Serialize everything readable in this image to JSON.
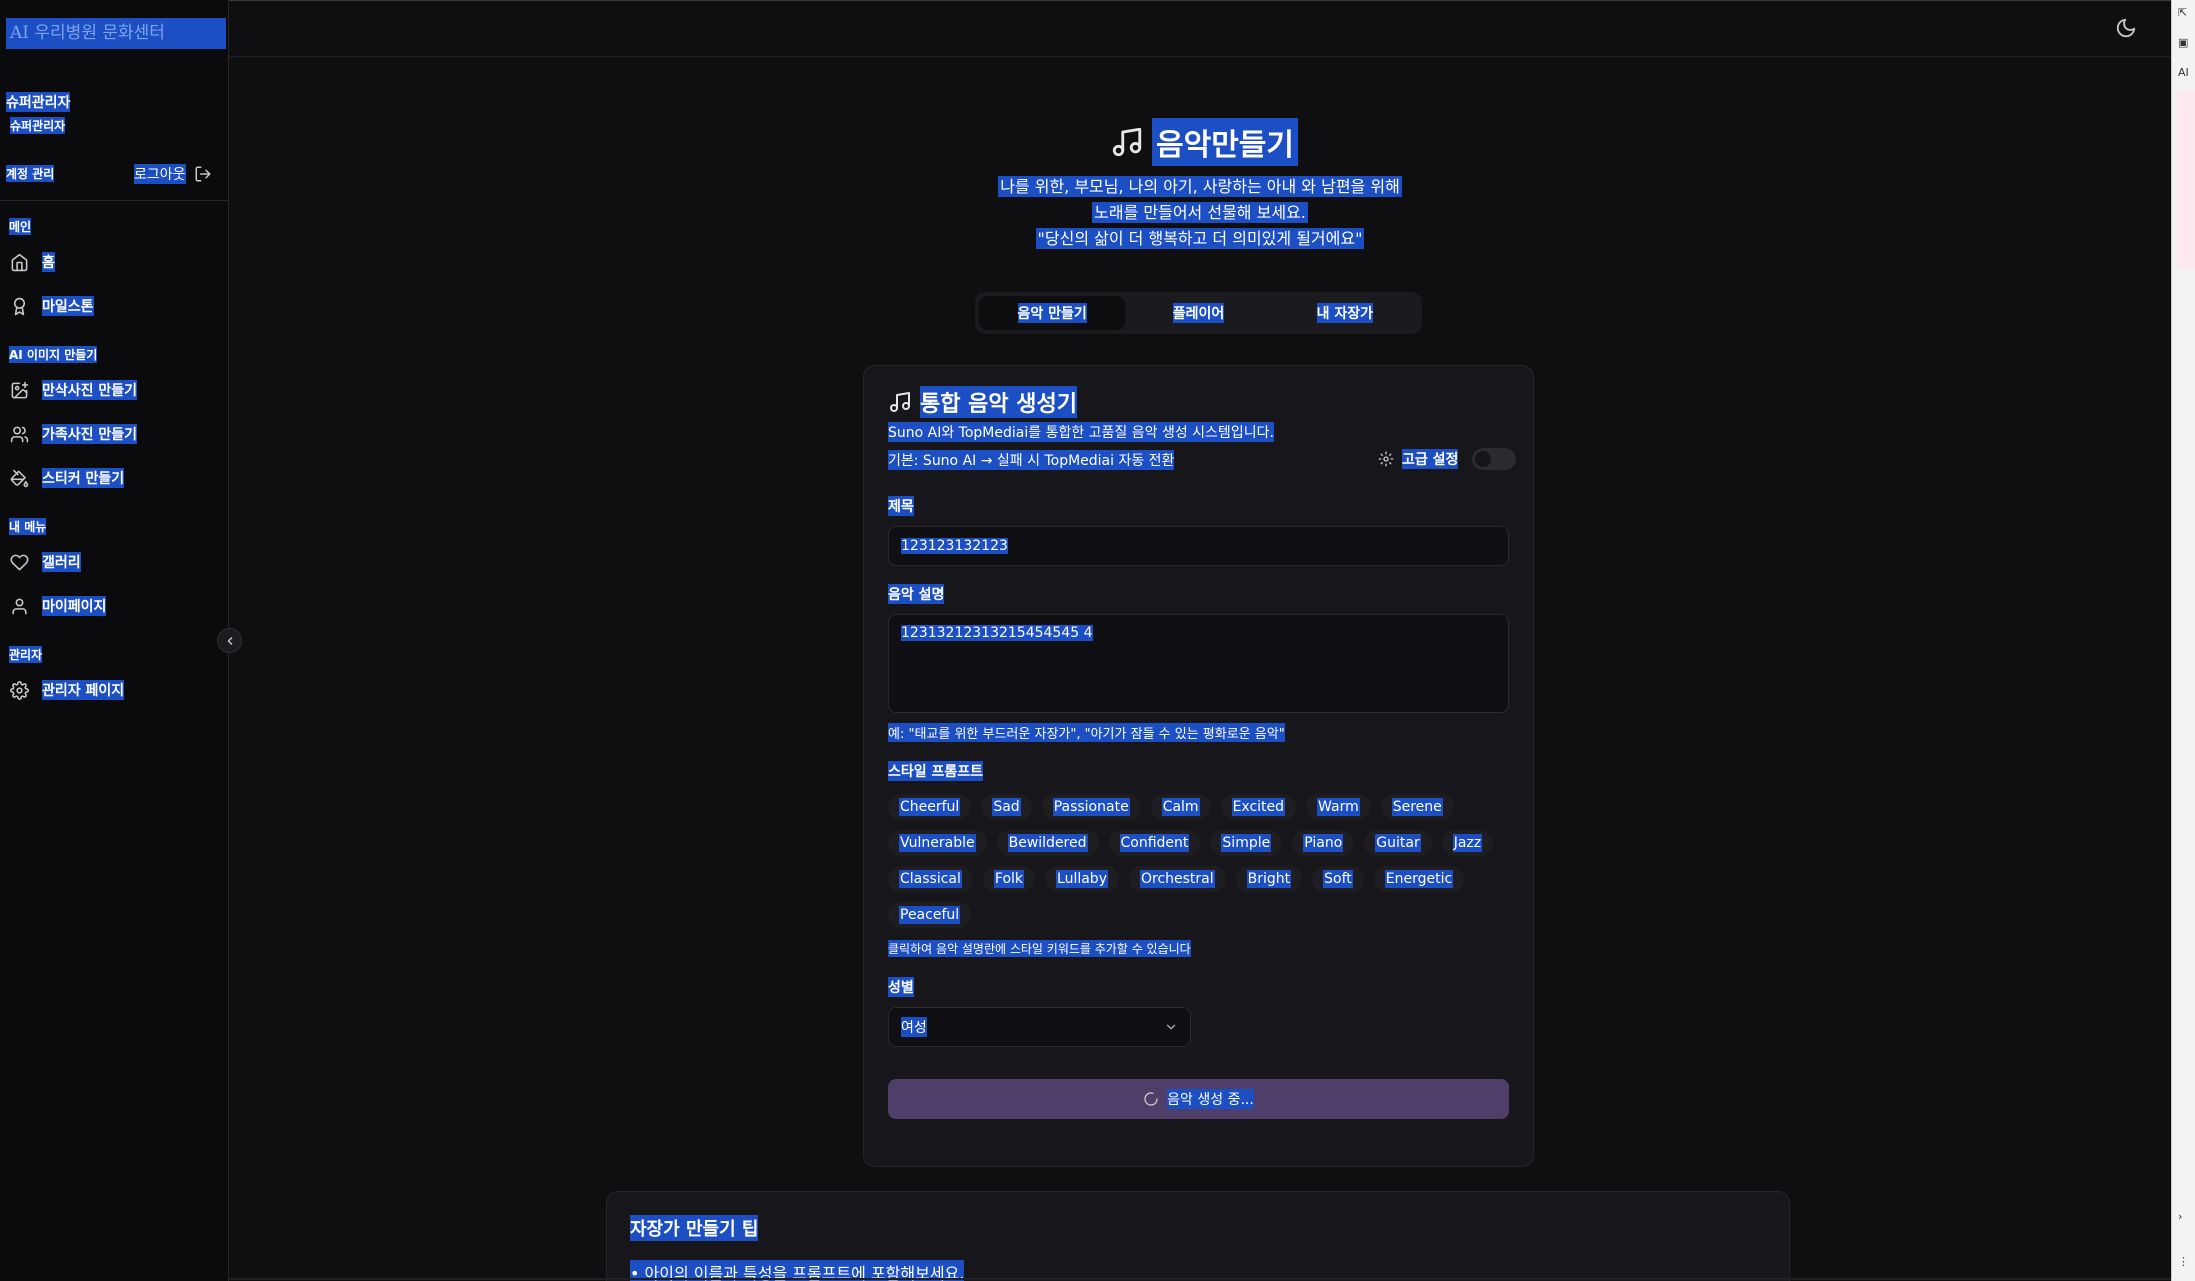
{
  "sidebar": {
    "logo": "AI 우리병원 문화센터",
    "user_name": "슈퍼관리자",
    "user_role": "슈퍼관리자",
    "account_label": "계정 관리",
    "logout_label": "로그아웃",
    "sections": {
      "main": "메인",
      "ai_image": "AI 이미지 만들기",
      "my_menu": "내 메뉴",
      "admin": "관리자"
    },
    "items": [
      {
        "label": "홈",
        "icon": "home-icon"
      },
      {
        "label": "마일스톤",
        "icon": "award-icon"
      },
      {
        "label": "만삭사진 만들기",
        "icon": "image-plus-icon"
      },
      {
        "label": "가족사진 만들기",
        "icon": "users-icon"
      },
      {
        "label": "스티커 만들기",
        "icon": "paint-bucket-icon"
      },
      {
        "label": "갤러리",
        "icon": "heart-icon"
      },
      {
        "label": "마이페이지",
        "icon": "user-icon"
      },
      {
        "label": "관리자 페이지",
        "icon": "gear-icon"
      }
    ]
  },
  "main": {
    "title": "음악만들기",
    "subtitle_lines": [
      "나를 위한, 부모님, 나의 아기, 사랑하는 아내 와 남편을 위해",
      "노래를 만들어서 선물해 보세요.",
      "\"당신의 삶이 더 행복하고 더 의미있게 될거에요\""
    ],
    "tabs": [
      "음악 만들기",
      "플레이어",
      "내 자장가"
    ],
    "card": {
      "title": "통합 음악 생성기",
      "sub1": "Suno AI와 TopMediai를 통합한 고품질 음악 생성 시스템입니다.",
      "sub2": "기본: Suno AI → 실패 시 TopMediai 자동 전환",
      "advanced_label": "고급 설정",
      "title_label": "제목",
      "title_value": "123123132123",
      "desc_label": "음악 설명",
      "desc_value": "12313212313215454545 4",
      "desc_hint": "예: \"태교를 위한 부드러운 자장가\", \"아기가 잠들 수 있는 평화로운 음악\"",
      "style_label": "스타일 프롬프트",
      "styles": [
        "Cheerful",
        "Sad",
        "Passionate",
        "Calm",
        "Excited",
        "Warm",
        "Serene",
        "Vulnerable",
        "Bewildered",
        "Confident",
        "Simple",
        "Piano",
        "Guitar",
        "Jazz",
        "Classical",
        "Folk",
        "Lullaby",
        "Orchestral",
        "Bright",
        "Soft",
        "Energetic",
        "Peaceful"
      ],
      "style_hint": "클릭하여 음악 설명란에 스타일 키워드를 추가할 수 있습니다",
      "gender_label": "성별",
      "gender_value": "여성",
      "submit_label": "음악 생성 중..."
    },
    "tips": {
      "title": "자장가 만들기 팁",
      "item": "• 아이의 이름과 특성을 프롬프트에 포함해보세요."
    }
  },
  "side_panel": {
    "label": "AI"
  },
  "colors": {
    "selection": "#1d4fc4",
    "background": "#0f0f12",
    "submit": "#4f3d6a"
  }
}
